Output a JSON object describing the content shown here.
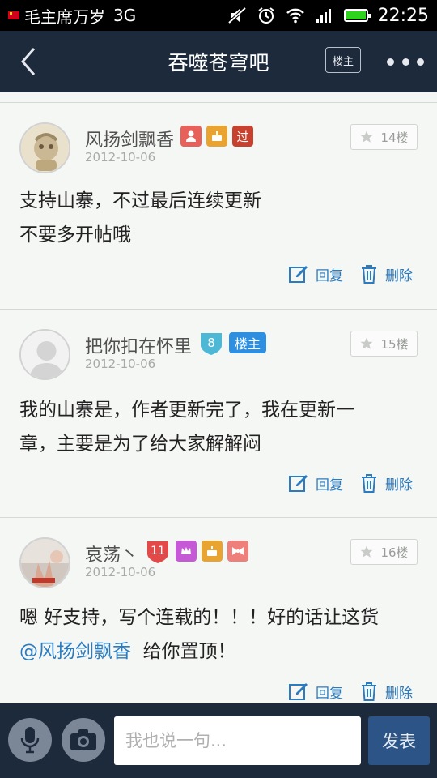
{
  "status_bar": {
    "carrier": "毛主席万岁",
    "network": "3G",
    "time": "22:25",
    "battery_level": 1.0,
    "icons": [
      "flag-icon",
      "mute-icon",
      "alarm-icon",
      "wifi-icon",
      "signal-icon",
      "battery-icon"
    ]
  },
  "header": {
    "back_icon": "chevron-left-icon",
    "title": "吞噬苍穹吧",
    "louzhu_label": "楼主",
    "more_icon": "more-dots-icon",
    "background": "#1c2a3c"
  },
  "posts": [
    {
      "username": "风扬剑飘香",
      "date": "2012-10-06",
      "floor": "14楼",
      "badges": [
        {
          "text": "",
          "color": "#e8605a",
          "icon": "person-icon"
        },
        {
          "text": "",
          "color": "#e8a330",
          "icon": "cake-icon"
        },
        {
          "text": "过",
          "color": "#c7412f"
        }
      ],
      "lines": [
        "支持山寨，不过最后连续更新",
        "不要多开帖哦"
      ],
      "reply_label": "回复",
      "delete_label": "删除"
    },
    {
      "username": "把你扣在怀里",
      "date": "2012-10-06",
      "floor": "15楼",
      "badges": [
        {
          "text": "8",
          "color": "#4cb8d6",
          "icon": "level-shield-icon"
        },
        {
          "text": "楼主",
          "color": "#2e8fe0"
        }
      ],
      "lines": [
        "我的山寨是，作者更新完了，我在更新一",
        "章，主要是为了给大家解解闷"
      ],
      "reply_label": "回复",
      "delete_label": "删除"
    },
    {
      "username": "哀荡丶",
      "date": "2012-10-06",
      "floor": "16楼",
      "badges": [
        {
          "text": "11",
          "color": "#e24a4a",
          "icon": "level-shield-icon"
        },
        {
          "text": "",
          "color": "#c65ad6",
          "icon": "crown-icon"
        },
        {
          "text": "",
          "color": "#e8a330",
          "icon": "cake-icon"
        },
        {
          "text": "",
          "color": "#ee7f7a",
          "icon": "bow-icon"
        }
      ],
      "line1": "嗯 好支持，写个连载的！！！好的话让这货",
      "mention": "@风扬剑飘香",
      "line2_rest": "  给你置顶！",
      "reply_label": "回复",
      "delete_label": "删除"
    }
  ],
  "bottom_bar": {
    "mic_icon": "microphone-icon",
    "camera_icon": "camera-icon",
    "input_placeholder": "我也说一句...",
    "input_value": "",
    "send_label": "发表"
  },
  "colors": {
    "accent_blue": "#2b7bc0",
    "dark_bar": "#1c2a3c",
    "send_button": "#2c5486"
  }
}
